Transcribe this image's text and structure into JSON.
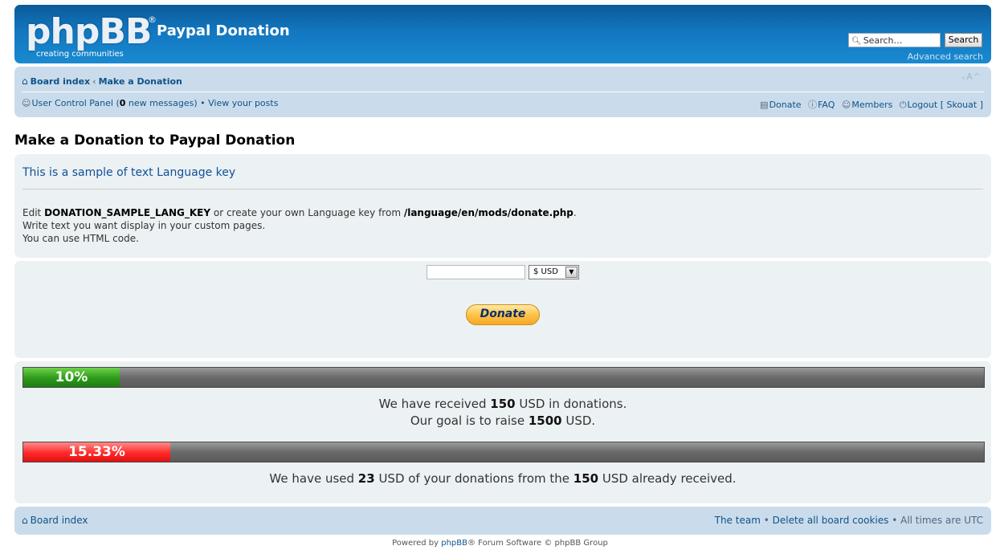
{
  "header": {
    "logo_word": "phpBB",
    "logo_reg": "®",
    "logo_tagline": "creating   communities",
    "site_title": "Paypal Donation",
    "search_placeholder": "Search…",
    "search_button": "Search",
    "advanced_search": "Advanced search"
  },
  "navbar": {
    "breadcrumb_home": "Board index",
    "breadcrumb_sep": "‹",
    "breadcrumb_current": "Make a Donation",
    "font_size_control": "ᵥA^",
    "ucp_label": "User Control Panel (",
    "new_messages_count": "0",
    "new_messages_label": " new messages)",
    "bullet": "•",
    "view_posts": "View your posts",
    "donate": "Donate",
    "faq": "FAQ",
    "members": "Members",
    "logout": "Logout [ Skouat ]"
  },
  "page": {
    "title": "Make a Donation to Paypal Donation"
  },
  "info": {
    "heading": "This is a sample of text Language key",
    "line1_pre": "Edit ",
    "line1_key": "DONATION_SAMPLE_LANG_KEY",
    "line1_mid": " or create your own Language key from ",
    "line1_path": "/language/en/mods/donate.php",
    "line1_end": ".",
    "line2": "Write text you want display in your custom pages.",
    "line3": "You can use HTML code."
  },
  "donate_form": {
    "amount_value": "",
    "currency_selected": "$ USD",
    "donate_button": "Donate"
  },
  "progress": {
    "received_percent": 10,
    "received_label": "10%",
    "received_text_pre": "We have received ",
    "received_amount": "150",
    "received_text_post": " USD in donations.",
    "goal_text_pre": "Our goal is to raise ",
    "goal_amount": "1500",
    "goal_text_post": " USD.",
    "used_percent": 15.33,
    "used_label": "15.33%",
    "used_text_pre": "We have used ",
    "used_amount": "23",
    "used_text_mid": " USD of your donations from the ",
    "used_total": "150",
    "used_text_post": " USD already received."
  },
  "footer": {
    "board_index": "Board index",
    "the_team": "The team",
    "bullet": "•",
    "delete_cookies": "Delete all board cookies",
    "timezone": "All times are UTC",
    "powered_pre": "Powered by ",
    "powered_link": "phpBB",
    "powered_post": "® Forum Software © phpBB Group"
  },
  "colors": {
    "header_blue": "#1277c0",
    "nav_bg": "#cadceb",
    "panel_bg": "#ecf1f3",
    "link": "#105289",
    "received_bar": "#2c9a1a",
    "used_bar": "#ff2a2a"
  }
}
